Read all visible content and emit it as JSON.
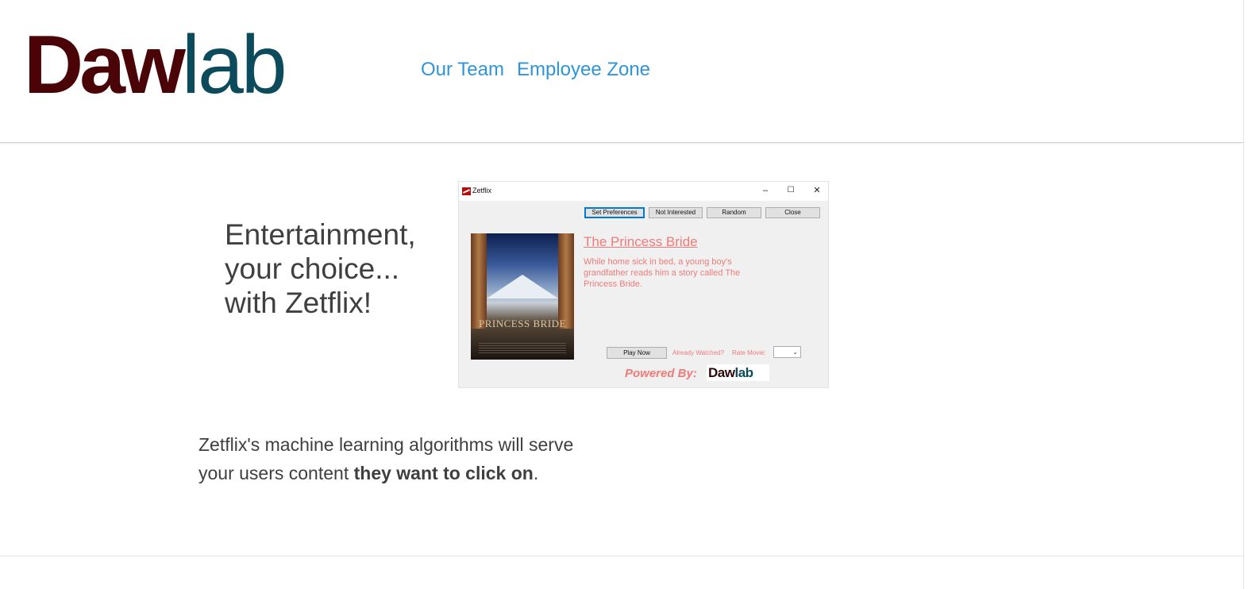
{
  "header": {
    "logo": {
      "part1": "Daw",
      "part2": "lab"
    },
    "nav": [
      {
        "label": "Our Team"
      },
      {
        "label": "Employee Zone"
      }
    ]
  },
  "hero": {
    "tagline": [
      "Entertainment,",
      "your choice...",
      "with Zetflix!"
    ]
  },
  "app_window": {
    "title": "Zetflix",
    "controls": {
      "minimize": "–",
      "maximize": "☐",
      "close": "✕"
    },
    "buttons": [
      "Set Preferences",
      "Not Interested",
      "Random",
      "Close"
    ],
    "poster_title": "PRINCESS BRIDE",
    "movie_title": "The Princess Bride",
    "movie_description": "While home sick in bed, a young boy's grandfather reads him a story called The Princess Bride.",
    "play_label": "Play Now",
    "already_watched": "Already Watched?",
    "rate_movie": "Rate Movie:",
    "powered_by": "Powered By:",
    "mini_logo": {
      "part1": "Daw",
      "part2": "lab"
    }
  },
  "blurb": {
    "text1": "Zetflix's machine learning algorithms will serve your users content ",
    "bold": "they want to click on",
    "text2": "."
  },
  "colors": {
    "logo_dark": "#4a0307",
    "logo_teal": "#0b4b5c",
    "nav_link": "#2f95d8",
    "movie_text": "#f07a7a"
  }
}
